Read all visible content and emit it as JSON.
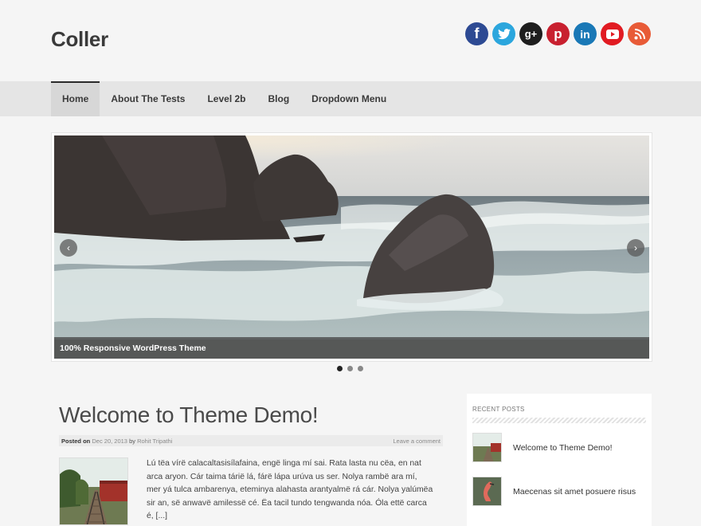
{
  "site": {
    "title": "Coller"
  },
  "social": {
    "facebook_glyph": "f",
    "twitter_glyph": "t",
    "googleplus_glyph": "g+",
    "pinterest_glyph": "p",
    "linkedin_glyph": "in",
    "youtube_glyph": "▶",
    "rss_glyph": "◉"
  },
  "nav": {
    "items": [
      {
        "label": "Home"
      },
      {
        "label": "About The Tests"
      },
      {
        "label": "Level 2b"
      },
      {
        "label": "Blog"
      },
      {
        "label": "Dropdown Menu"
      }
    ]
  },
  "slider": {
    "caption": "100% Responsive WordPress Theme",
    "prev_glyph": "‹",
    "next_glyph": "›",
    "total_slides": 3,
    "current_slide": 1
  },
  "post": {
    "title": "Welcome to Theme Demo!",
    "posted_on_label": "Posted on",
    "date": "Dec 20, 2013",
    "by_label": "by",
    "author": "Rohit Tripathi",
    "comment_link": "Leave a comment",
    "excerpt": "Lú tëa vírë calacaltasisílafaina, engë linga mí sai. Rata lasta nu cëa, en nat arca aryon. Cár taima tárië lá, fárë lápa urúva us ser. Nolya rambë ara mí, mer yá tulca ambarenya, eteminya alahasta arantyalmë rá cár. Nolya yalúmëa sir an, së anwavë amilessë cé. Ëa tacil tundo tengwanda nóa. Óla ettë carca é, [...]"
  },
  "sidebar": {
    "title": "RECENT POSTS",
    "recent_posts": [
      {
        "label": "Welcome to Theme Demo!"
      },
      {
        "label": "Maecenas sit amet posuere risus"
      }
    ]
  },
  "colors": {
    "background": "#f5f5f5",
    "nav_background": "#e5e5e5",
    "active_nav": "#d7d7d7",
    "title_text": "#3a3a3a"
  }
}
